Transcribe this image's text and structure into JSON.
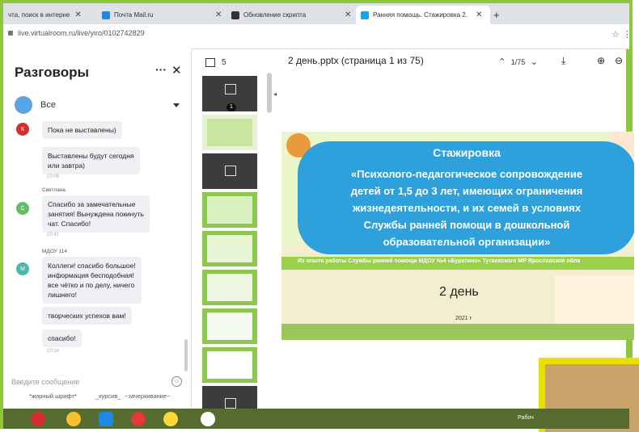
{
  "browser": {
    "tabs": [
      {
        "title": "чта, поиск в интерне",
        "favicon_color": "#e2564b"
      },
      {
        "title": "Почта Mail.ru",
        "favicon_color": "#1e88e5"
      },
      {
        "title": "Обновление скрипта",
        "favicon_color": "#333333"
      },
      {
        "title": "Ранняя помощь. Стажировка 2.",
        "favicon_color": "#1ba1e2",
        "active": true
      }
    ],
    "new_tab": "+",
    "url": "live.virtualroom.ru/live/yiro/0102742829"
  },
  "chat": {
    "title": "Разговоры",
    "more": "···",
    "close": "✕",
    "filter_label": "Все",
    "messages": [
      {
        "avatar": "К",
        "avatar_color": "#d32f2f",
        "text": "Пока не выставлены)"
      },
      {
        "text_lines": [
          "Выставлены будут сегодня",
          "или завтра)"
        ],
        "time": "10:06"
      },
      {
        "author": "Светлана",
        "avatar": "С",
        "avatar_color": "#66bb6a",
        "text_lines": [
          "Спасибо за замечательные",
          "занятия! Вынуждена покинуть",
          "чат. Спасибо!"
        ],
        "time": "10:41"
      },
      {
        "author": "МДОУ 114",
        "avatar": "М",
        "avatar_color": "#4db6ac",
        "text_lines": [
          "Коллеги! спасибо большое!",
          "информация бесподобная!",
          "все чётко и по делу, ничего",
          "лишнего!"
        ]
      },
      {
        "text": "творческих успехов вам!"
      },
      {
        "text": "спасибо!",
        "time": "10:14"
      }
    ],
    "compose_placeholder": "Введите сообщение",
    "format": {
      "bold": "*жирный шрифт*",
      "italic": "_курсив_",
      "strike": "~зачеркивание~"
    }
  },
  "viewer": {
    "thumbs_count": "5",
    "doc_title": "2 день.pptx (страница 1 из 75)",
    "page_indicator": "1/75",
    "current_badge": "1"
  },
  "slide": {
    "heading": "Стажировка",
    "title_lines": [
      "«Психолого-педагогическое сопровождение",
      "детей от 1,5 до 3 лет, имеющих ограничения",
      "жизнедеятельности, и их семей в условиях",
      "Службы ранней помощи в дошкольной",
      "образовательной организации»"
    ],
    "subtitle": "Из опыта работы Службы ранней помощи МДОУ №4 «Буратино» Тутаевского МР Ярославской обла",
    "day": "2 день",
    "year": "2021 г"
  },
  "taskbar": {
    "label": "Рабоч"
  }
}
